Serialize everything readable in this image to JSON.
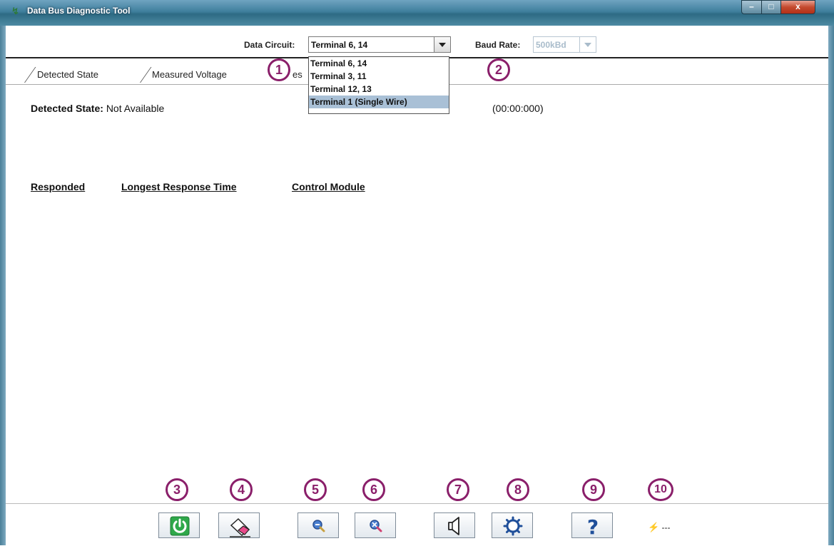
{
  "window": {
    "title": "Data Bus Diagnostic Tool",
    "icon": "app-logo-icon",
    "controls": {
      "minimize": "–",
      "maximize": "□",
      "close": "x"
    }
  },
  "toolbar": {
    "data_circuit_label": "Data Circuit:",
    "data_circuit_value": "Terminal 6, 14",
    "baud_rate_label": "Baud Rate:",
    "baud_rate_value": "500kBd"
  },
  "dropdown": {
    "options": [
      "Terminal 6, 14",
      "Terminal 3, 11",
      "Terminal 12, 13",
      "Terminal 1 (Single Wire)"
    ],
    "selected_index": 3
  },
  "tabs": [
    {
      "label": "Detected State"
    },
    {
      "label": "Measured Voltage"
    },
    {
      "label": "es"
    }
  ],
  "body": {
    "detected_state_label": "Detected State:",
    "detected_state_value": "Not Available",
    "timestamp": "(00:00:000)",
    "columns": [
      "Responded",
      "Longest Response Time",
      "Control Module"
    ]
  },
  "badges": [
    "1",
    "2",
    "3",
    "4",
    "5",
    "6",
    "7",
    "8",
    "9",
    "10"
  ],
  "bottom_toolbar": {
    "buttons": [
      {
        "icon": "power-icon"
      },
      {
        "icon": "eraser-icon"
      },
      {
        "icon": "zoom-out-icon"
      },
      {
        "icon": "zoom-reset-icon"
      },
      {
        "icon": "speaker-icon"
      },
      {
        "icon": "gear-icon"
      },
      {
        "icon": "help-icon"
      }
    ],
    "status_icon": "lightning-icon",
    "status_text": "---"
  },
  "colors": {
    "badge": "#8a1f6a",
    "power_green": "#2fa84a",
    "title_bar": "#3f7f9d"
  }
}
